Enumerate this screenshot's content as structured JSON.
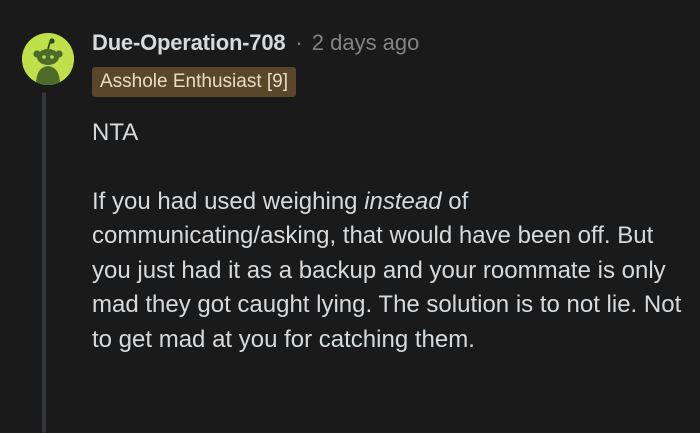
{
  "comment": {
    "author": "Due-Operation-708",
    "separator": "·",
    "timestamp": "2 days ago",
    "flair": "Asshole Enthusiast [9]",
    "avatar_icon": "snoo-avatar-icon",
    "flair_color": "#5a4628",
    "avatar_color": "#bfe04a",
    "body": {
      "verdict": "NTA",
      "p1_before": "If you had used weighing ",
      "p1_emphasis": "instead",
      "p1_after": " of communicating/asking, that would have been off. But you just had it as a backup and your roommate is only mad they got caught lying. The solution is to not lie. Not to get mad at you for catching them."
    }
  }
}
